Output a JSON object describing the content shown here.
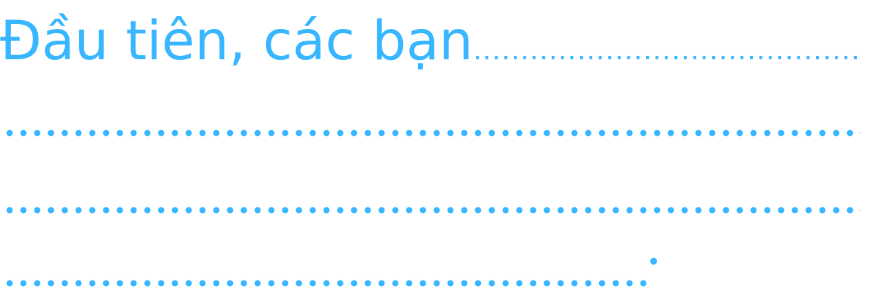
{
  "document": {
    "line1_text": "Đầu tiên, các bạn",
    "line1_dots": "...............................................",
    "line2_dots": "................................................................",
    "line3_dots": "................................................................",
    "line4_dots": "................................................:"
  },
  "colors": {
    "text": "#38b6ff",
    "background": "#ffffff"
  }
}
